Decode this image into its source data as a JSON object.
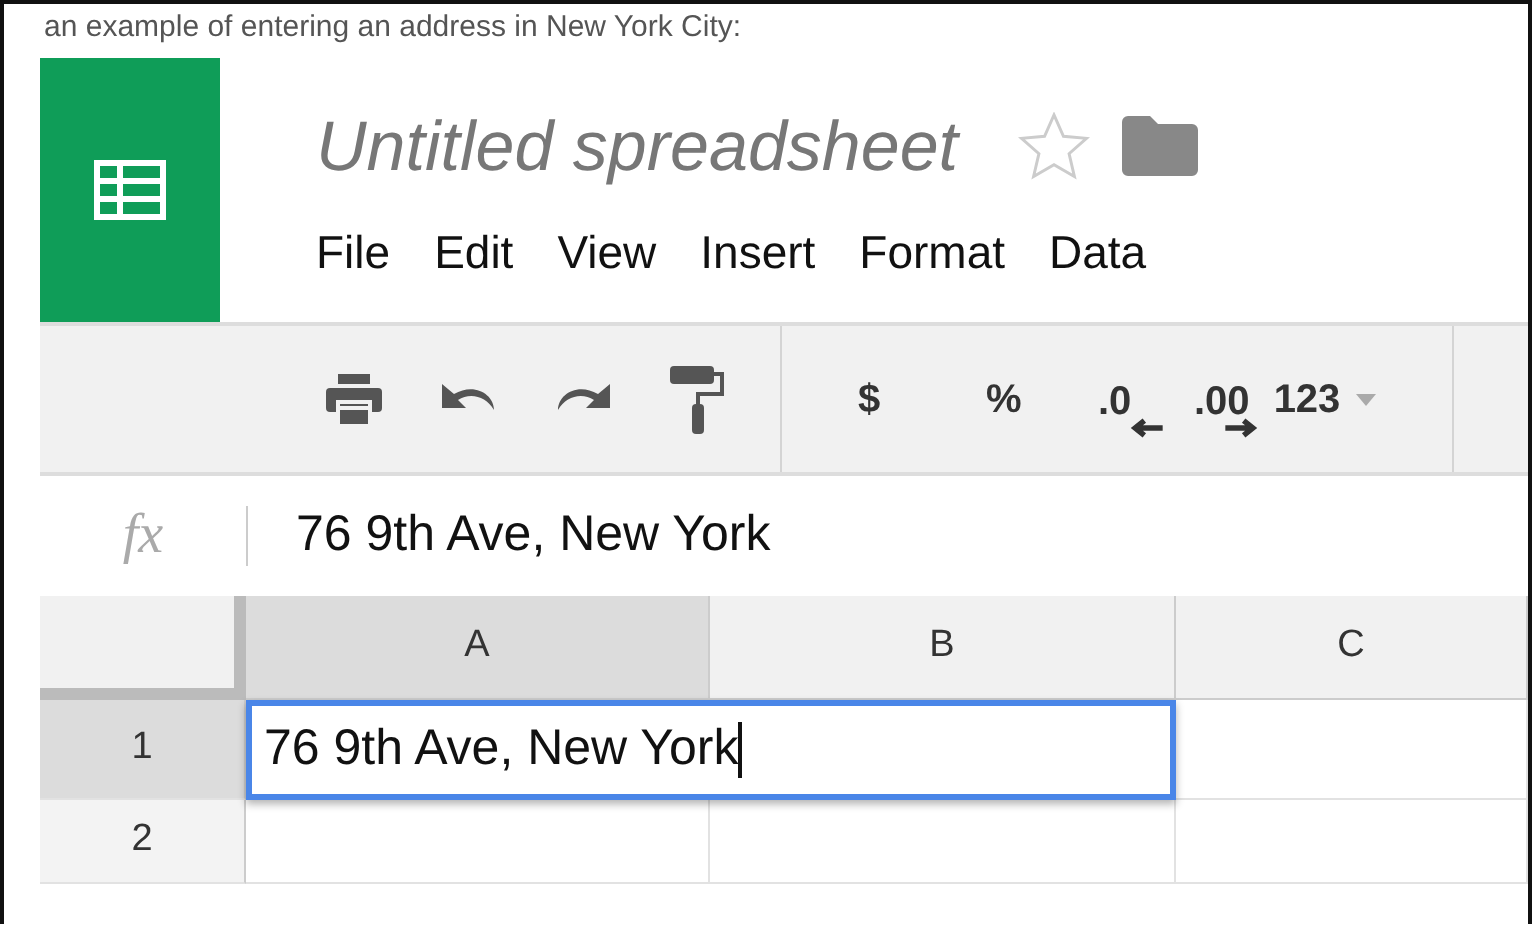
{
  "caption": "an example of entering an address in New York City:",
  "document": {
    "title": "Untitled spreadsheet",
    "starred": false
  },
  "menu": [
    "File",
    "Edit",
    "View",
    "Insert",
    "Format",
    "Data"
  ],
  "toolbar": [
    {
      "kind": "print"
    },
    {
      "kind": "undo"
    },
    {
      "kind": "redo"
    },
    {
      "kind": "roller"
    },
    {
      "kind": "divider"
    },
    {
      "kind": "text",
      "label": "$"
    },
    {
      "kind": "text",
      "label": "%"
    },
    {
      "kind": "decrease",
      "label": ".0"
    },
    {
      "kind": "increase",
      "label": ".00"
    },
    {
      "kind": "dropdown",
      "label": "123"
    },
    {
      "kind": "divider"
    }
  ],
  "formula_bar": {
    "label": "fx",
    "value": "76 9th Ave, New York"
  },
  "columns": [
    {
      "label": "A",
      "selected": true
    },
    {
      "label": "B",
      "selected": false
    },
    {
      "label": "C",
      "selected": false
    }
  ],
  "rows": [
    {
      "label": "1",
      "selected": true,
      "cells": [
        {
          "value": "76 9th Ave, New York",
          "editing": true
        },
        {
          "editing": false
        }
      ]
    },
    {
      "label": "2",
      "selected": false,
      "cells": [
        {
          "editing": false
        },
        {
          "editing": false
        },
        {
          "editing": false
        }
      ]
    }
  ]
}
